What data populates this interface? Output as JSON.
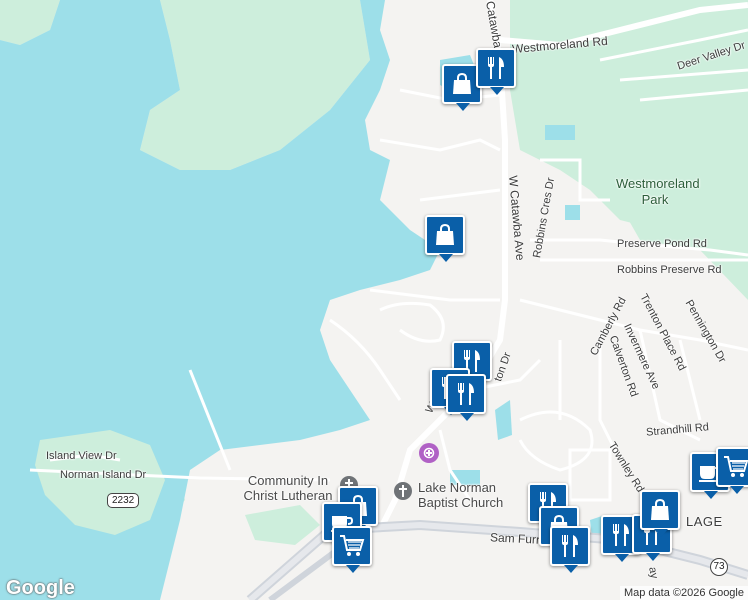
{
  "colors": {
    "water": "#9ddfe9",
    "park": "#cdeedc",
    "land": "#f4f3f1",
    "pin": "#0a5fa8",
    "road": "#ffffff",
    "highway": "#cfd4db"
  },
  "labels": {
    "westmoreland_rd": "Westmoreland Rd",
    "deer_valley": "Deer Valley Dr",
    "catawba_top": "Catawba",
    "w_catawba_ave": "W Catawba Ave",
    "robbins_cres": "Robbins Cres Dr",
    "westmoreland_park": "Westmoreland Park",
    "preserve_pond": "Preserve Pond Rd",
    "robbins_preserve": "Robbins Preserve Rd",
    "camberly": "Camberly Rd",
    "trenton": "Trenton Place Rd",
    "pennington": "Pennington Dr",
    "invermere": "Invermere Ave",
    "calverton": "Calverton Rd",
    "strandhill": "Strandhill Rd",
    "townley": "Townley Rd",
    "island_view": "Island View Dr",
    "norman_island": "Norman Island Dr",
    "community_church": "Community In Christ Lutheran",
    "baptist_church": "Lake Norman Baptist Church",
    "sam_furr": "Sam Furr Rd",
    "ton_dr": "ton Dr",
    "w_fragment": "W",
    "lage": "LAGE",
    "ay": "ay",
    "route_2232": "2232",
    "route_73": "73"
  },
  "markers": [
    {
      "type": "shopping-bag"
    },
    {
      "type": "restaurant"
    },
    {
      "type": "shopping-bag"
    },
    {
      "type": "restaurant"
    },
    {
      "type": "restaurant"
    },
    {
      "type": "restaurant"
    },
    {
      "type": "shopping-bag"
    },
    {
      "type": "coffee"
    },
    {
      "type": "shopping-cart"
    },
    {
      "type": "restaurant"
    },
    {
      "type": "shopping-bag"
    },
    {
      "type": "restaurant"
    },
    {
      "type": "restaurant"
    },
    {
      "type": "restaurant"
    },
    {
      "type": "coffee"
    },
    {
      "type": "shopping-cart"
    },
    {
      "type": "shopping-bag"
    }
  ],
  "footer": {
    "logo": "Google",
    "attribution": "Map data ©2026 Google"
  }
}
